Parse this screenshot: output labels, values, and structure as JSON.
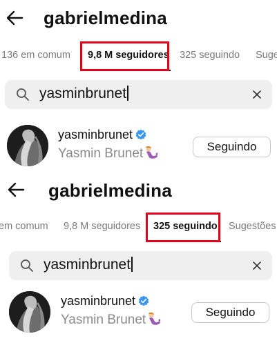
{
  "panels": [
    {
      "profile_username": "gabrielmedina",
      "tabs": [
        {
          "label": "136 em comum",
          "active": false
        },
        {
          "label": "9,8 M seguidores",
          "active": true
        },
        {
          "label": "325 seguindo",
          "active": false
        },
        {
          "label": "Suge",
          "active": false
        }
      ],
      "search_query": "yasminbrunet",
      "result": {
        "username": "yasminbrunet",
        "full_name": "Yasmin Brunet",
        "button_label": "Seguindo"
      }
    },
    {
      "profile_username": "gabrielmedina",
      "tabs": [
        {
          "label": "em comum",
          "active": false
        },
        {
          "label": "9,8 M seguidores",
          "active": false
        },
        {
          "label": "325 seguindo",
          "active": true
        },
        {
          "label": "Sugestões",
          "active": false
        }
      ],
      "search_query": "yasminbrunet",
      "result": {
        "username": "yasminbrunet",
        "full_name": "Yasmin Brunet",
        "button_label": "Seguindo"
      }
    }
  ],
  "colors": {
    "highlight": "#e3001b",
    "verified": "#3897f0",
    "muted_text": "#8a8a8a",
    "search_bg": "#efefef"
  },
  "icons": {
    "back": "arrow-left",
    "search": "magnifier",
    "clear": "x",
    "verified": "verified-badge",
    "name_emoji": "mermaid-emoji"
  }
}
